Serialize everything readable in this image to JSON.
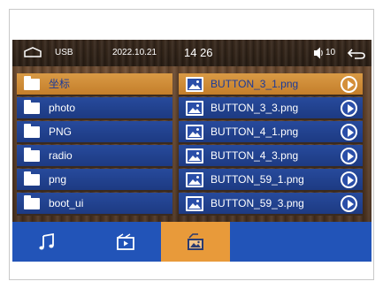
{
  "status_bar": {
    "source": "USB",
    "date": "2022.10.21",
    "time": "14 26",
    "volume": "10"
  },
  "folders": [
    {
      "label": "坐标",
      "selected": true
    },
    {
      "label": "photo",
      "selected": false
    },
    {
      "label": "PNG",
      "selected": false
    },
    {
      "label": "radio",
      "selected": false
    },
    {
      "label": "png",
      "selected": false
    },
    {
      "label": "boot_ui",
      "selected": false
    }
  ],
  "files": [
    {
      "label": "BUTTON_3_1.png",
      "selected": true
    },
    {
      "label": "BUTTON_3_3.png",
      "selected": false
    },
    {
      "label": "BUTTON_4_1.png",
      "selected": false
    },
    {
      "label": "BUTTON_4_3.png",
      "selected": false
    },
    {
      "label": "BUTTON_59_1.png",
      "selected": false
    },
    {
      "label": "BUTTON_59_3.png",
      "selected": false
    }
  ],
  "tabs": [
    {
      "icon": "music-note-icon",
      "active": false
    },
    {
      "icon": "video-icon",
      "active": false
    },
    {
      "icon": "picture-icon",
      "active": true
    }
  ],
  "colors": {
    "row_blue": "#1d3a82",
    "row_selected": "#c47e2b",
    "tab_bar": "#2254b8",
    "tab_active": "#e89a3a"
  }
}
